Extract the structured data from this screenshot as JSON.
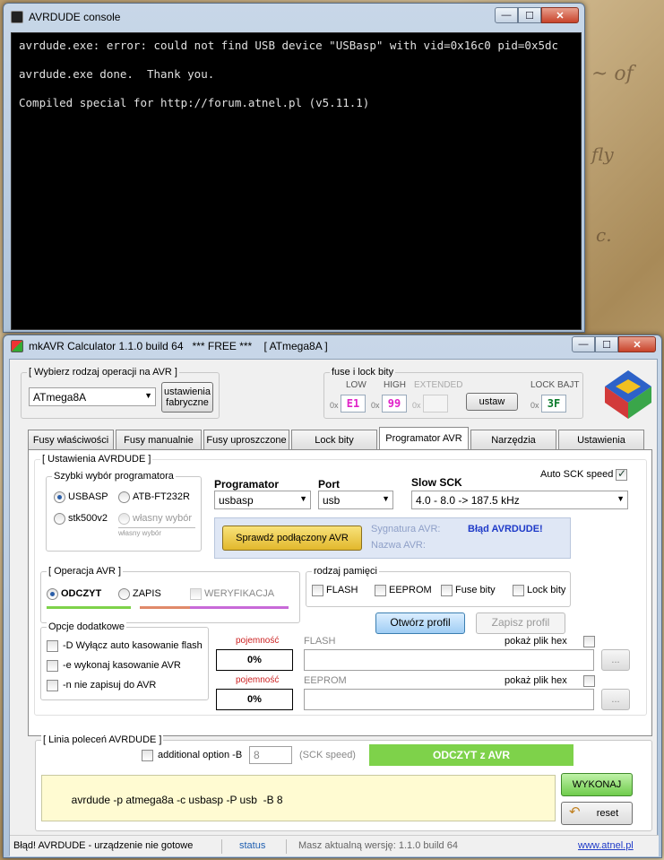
{
  "console": {
    "title": "AVRDUDE console",
    "lines": [
      "avrdude.exe: error: could not find USB device \"USBasp\" with vid=0x16c0 pid=0x5dc",
      "avrdude.exe done.  Thank you.",
      "Compiled special for http://forum.atnel.pl (v5.11.1)"
    ]
  },
  "main": {
    "title": "mkAVR Calculator 1.1.0 build 64   *** FREE ***    [ ATmega8A ]",
    "mcu_group_label": "[ Wybierz rodzaj operacji na AVR ]",
    "mcu_selected": "ATmega8A",
    "factory_btn_line1": "ustawienia",
    "factory_btn_line2": "fabryczne",
    "fuse_group_label": "fuse i lock bity",
    "fuse": {
      "low_label": "LOW",
      "low_prefix": "0x",
      "low_value": "E1",
      "low_color": "#e020c8",
      "high_label": "HIGH",
      "high_prefix": "0x",
      "high_value": "99",
      "high_color": "#e020c8",
      "ext_label": "EXTENDED",
      "ext_prefix": "0x",
      "ext_value": "",
      "set_btn": "ustaw",
      "lock_label": "LOCK BAJT",
      "lock_prefix": "0x",
      "lock_value": "3F",
      "lock_color": "#0a7a2a"
    },
    "tabs": [
      "Fusy właściwości",
      "Fusy manualnie",
      "Fusy uproszczone",
      "Lock bity",
      "Programator AVR",
      "Narzędzia",
      "Ustawienia"
    ],
    "active_tab": "Programator AVR",
    "avrdude_group_label": "[ Ustawienia AVRDUDE ]",
    "quick_prog_label": "Szybki wybór programatora",
    "radios": {
      "usbasp": "USBASP",
      "atb": "ATB-FT232R",
      "stk": "stk500v2",
      "own": "własny wybór",
      "own_sub": "własny wybór"
    },
    "programmer_label": "Programator",
    "programmer_value": "usbasp",
    "port_label": "Port",
    "port_value": "usb",
    "sck_label": "Slow SCK",
    "sck_value": "4.0 - 8.0 -> 187.5 kHz",
    "auto_sck_label": "Auto SCK speed",
    "auto_sck_checked": true,
    "check_btn": "Sprawdź podłączony AVR",
    "signature_label": "Sygnatura AVR:",
    "signature_value": "Błąd AVRDUDE!",
    "name_label": "Nazwa AVR:",
    "operation_label": "[ Operacja AVR ]",
    "op_read": "ODCZYT",
    "op_write": "ZAPIS",
    "op_verify": "WERYFIKACJA",
    "op_read_color": "#7ed24a",
    "op_write_color": "#e08a6a",
    "op_verify_color": "#c86ad8",
    "memory_label": "rodzaj pamięci",
    "mem_flash": "FLASH",
    "mem_eeprom": "EEPROM",
    "mem_fuse": "Fuse bity",
    "mem_lock": "Lock bity",
    "open_profile": "Otwórz profil",
    "save_profile": "Zapisz profil",
    "extra_label": "Opcje dodatkowe",
    "opt_d": "-D Wyłącz auto kasowanie flash",
    "opt_e": "-e wykonaj kasowanie AVR",
    "opt_n": "-n nie zapisuj do AVR",
    "flash_pct_label": "pojemność",
    "flash_pct": "0%",
    "flash_label": "FLASH",
    "flash_hex_label": "pokaż plik hex",
    "eeprom_pct_label": "pojemność",
    "eeprom_pct": "0%",
    "eeprom_label": "EEPROM",
    "eeprom_hex_label": "pokaż plik hex",
    "browse_btn": "...",
    "cmd_group_label": "[ Linia poleceń AVRDUDE ]",
    "additional_option": "additional option -B",
    "b_value": "8",
    "sck_speed_hint": "(SCK speed)",
    "mode_banner": "ODCZYT z AVR",
    "command": "avrdude -p atmega8a -c usbasp -P usb  -B 8",
    "execute_btn": "WYKONAJ",
    "reset_btn": "reset"
  },
  "status": {
    "message": "Błąd! AVRDUDE - urządzenie nie gotowe",
    "status_link": "status",
    "version_msg": "Masz aktualną wersję: 1.1.0 build 64",
    "website": "www.atnel.pl"
  }
}
